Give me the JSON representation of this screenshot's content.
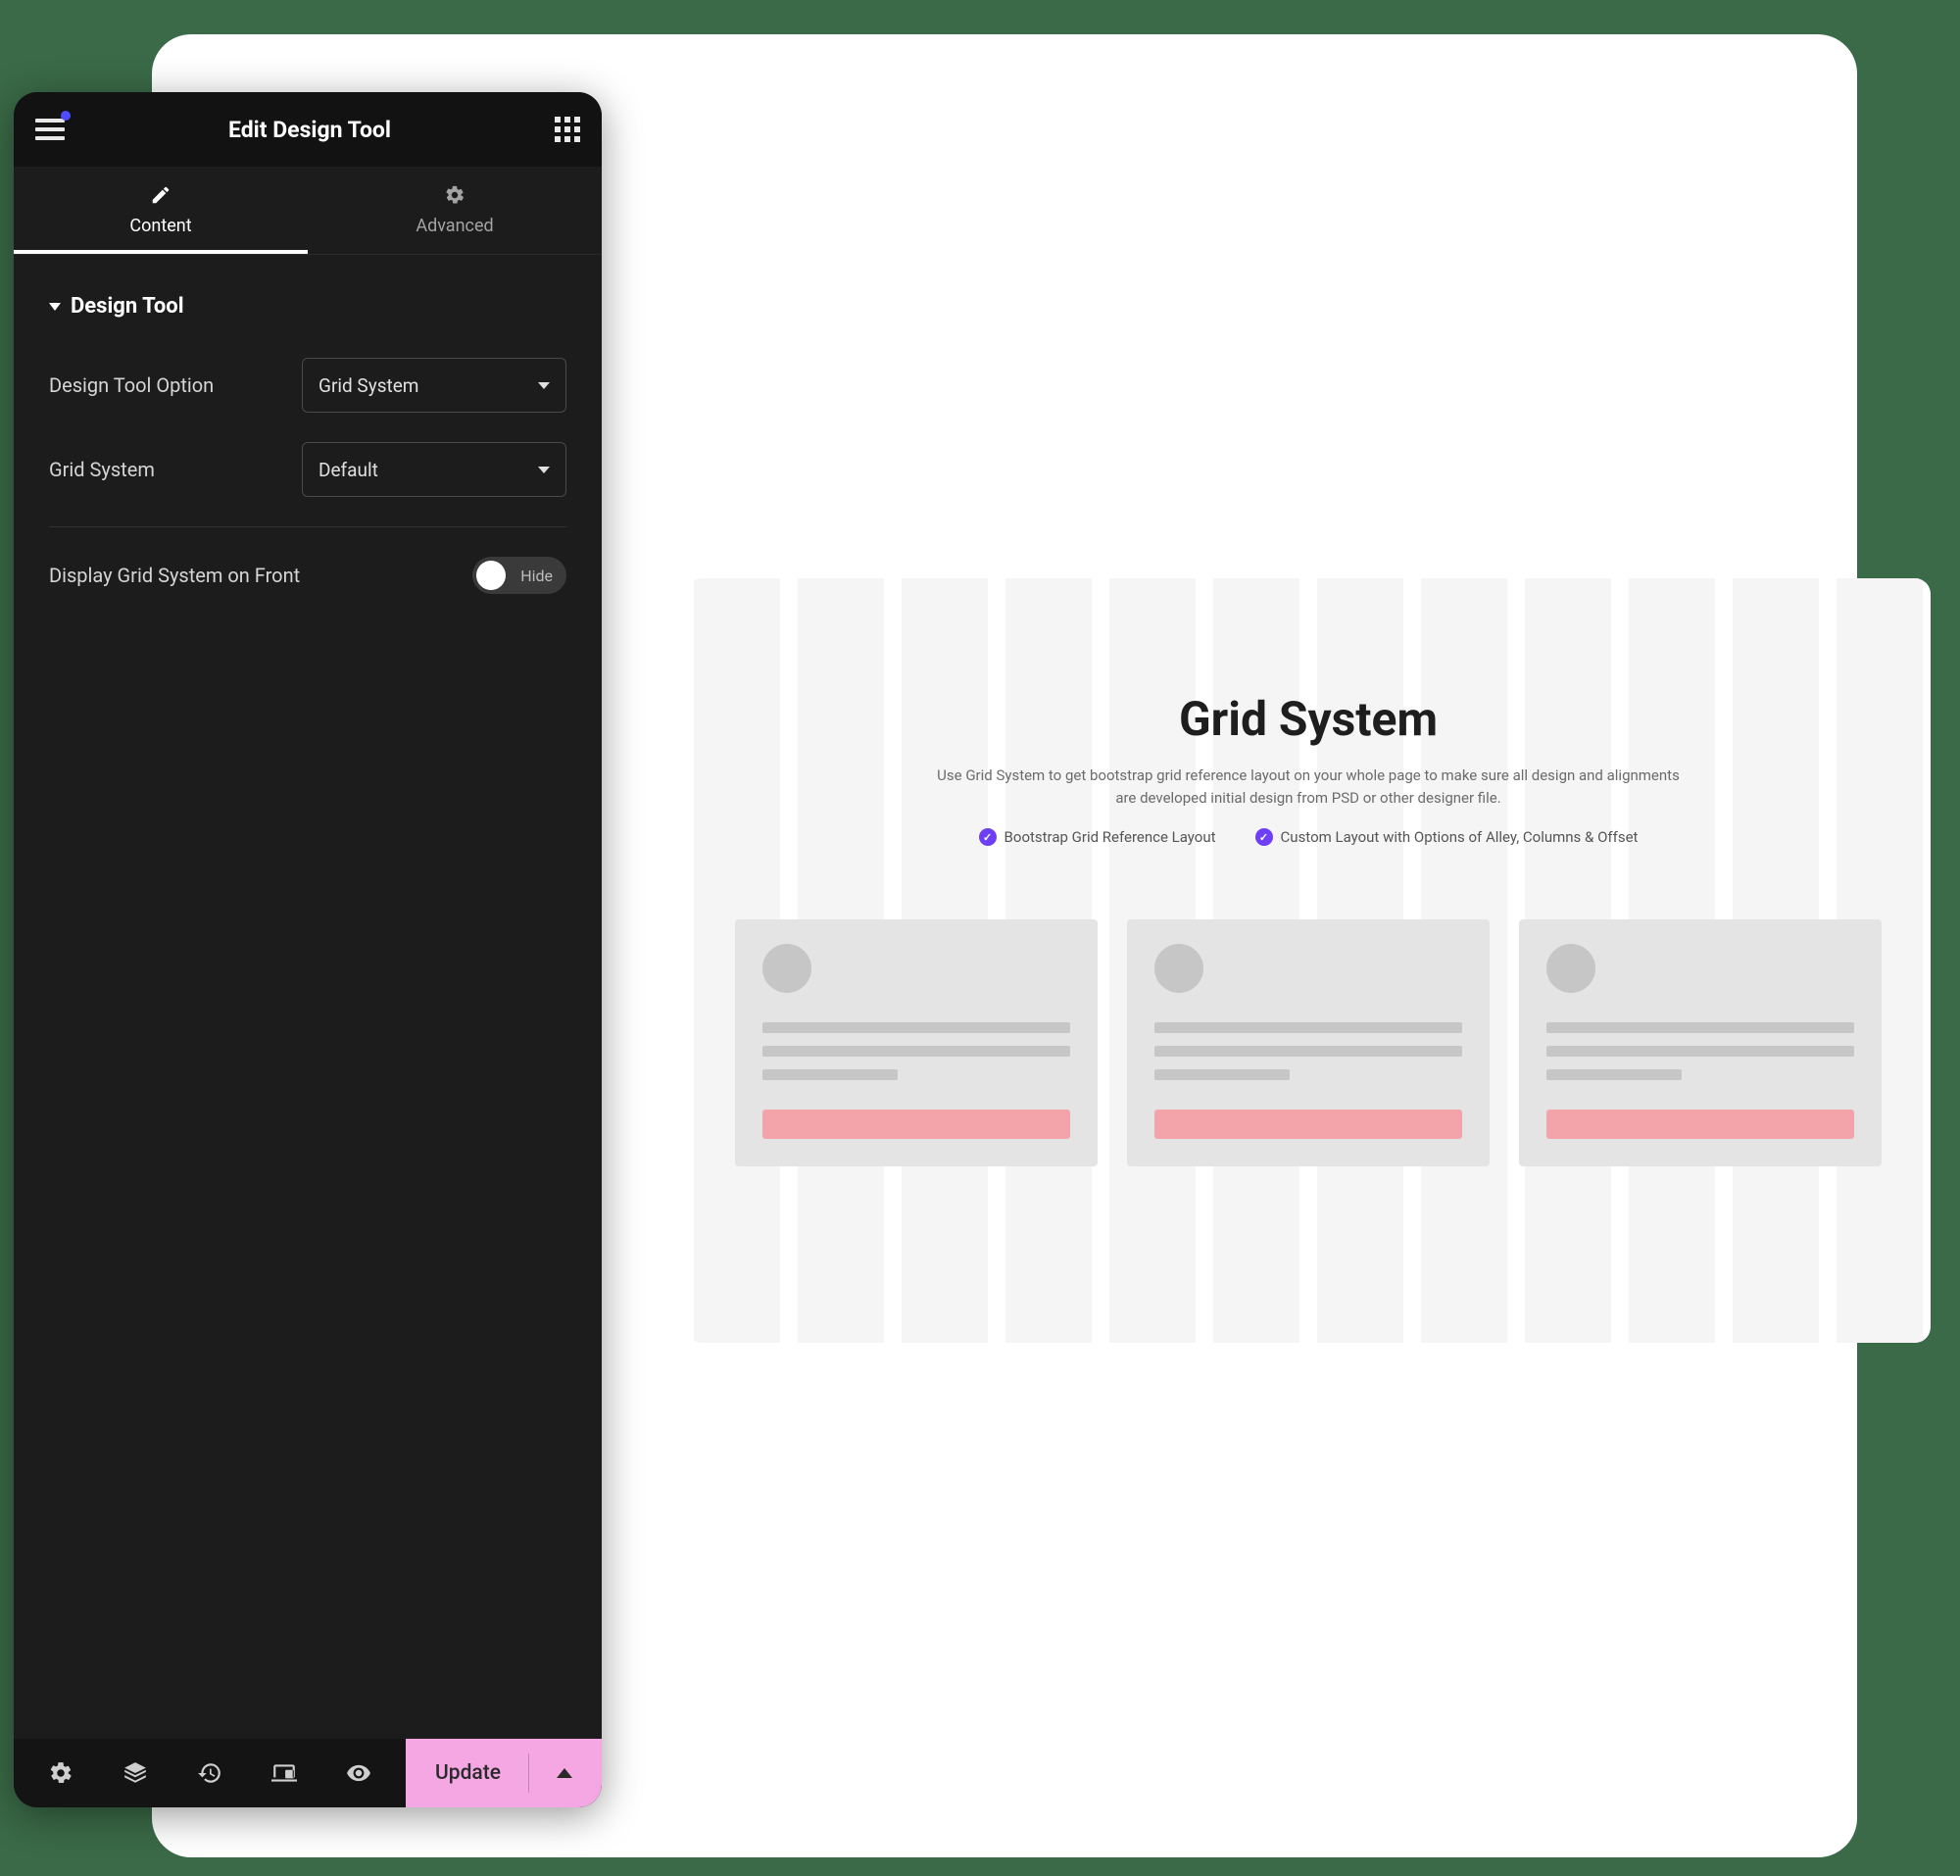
{
  "editor": {
    "title": "Edit Design Tool",
    "tabs": {
      "content": "Content",
      "advanced": "Advanced"
    },
    "section_title": "Design Tool",
    "controls": {
      "option_label": "Design Tool Option",
      "option_value": "Grid System",
      "grid_label": "Grid System",
      "grid_value": "Default",
      "display_label": "Display Grid System on Front",
      "display_state": "Hide"
    },
    "footer": {
      "update": "Update"
    }
  },
  "preview": {
    "title": "Grid System",
    "description": "Use Grid System to get bootstrap grid reference layout on your whole page to make sure all design and alignments are developed initial design from PSD or other designer file.",
    "features": [
      "Bootstrap Grid Reference Layout",
      "Custom Layout with Options of Alley, Columns & Offset"
    ]
  }
}
